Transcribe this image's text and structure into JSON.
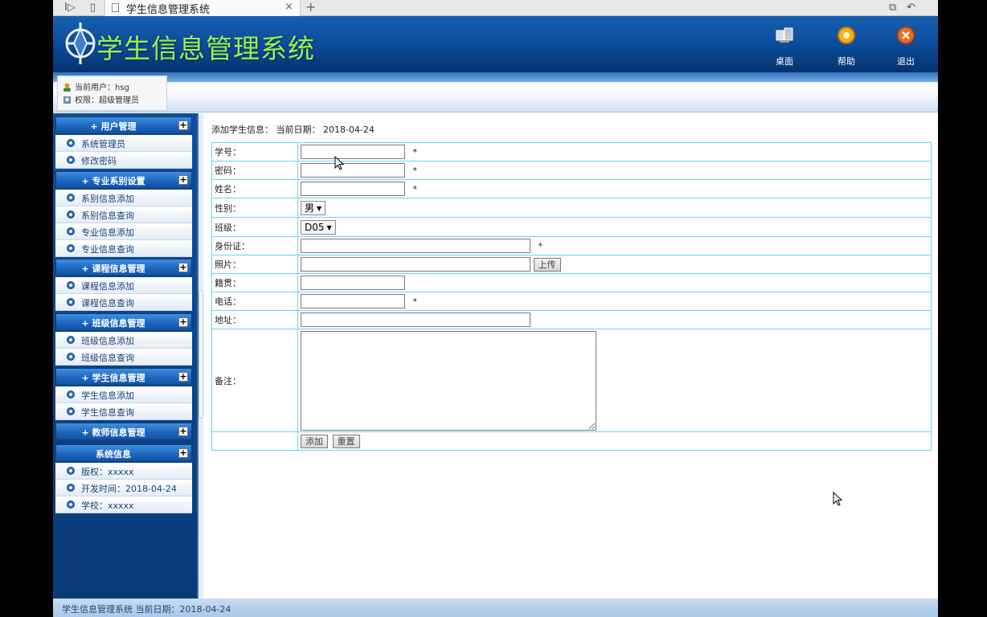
{
  "browser": {
    "tab_title": "学生信息管理系统",
    "tab_close": "×",
    "new_tab": "+"
  },
  "header": {
    "title": "学生信息管理系统",
    "buttons": [
      {
        "label": "桌面",
        "icon": "desktop-icon"
      },
      {
        "label": "帮助",
        "icon": "help-icon"
      },
      {
        "label": "退出",
        "icon": "exit-icon"
      }
    ]
  },
  "userbar": {
    "current_user": "当前用户：hsg",
    "permission": "权限：超级管理员"
  },
  "sidebar": {
    "groups": [
      {
        "title": "+ 用户管理",
        "items": [
          "系统管理员",
          "修改密码"
        ]
      },
      {
        "title": "+ 专业系别设置",
        "items": [
          "系别信息添加",
          "系别信息查询",
          "专业信息添加",
          "专业信息查询"
        ]
      },
      {
        "title": "+ 课程信息管理",
        "items": [
          "课程信息添加",
          "课程信息查询"
        ]
      },
      {
        "title": "+ 班级信息管理",
        "items": [
          "班级信息添加",
          "班级信息查询"
        ]
      },
      {
        "title": "+ 学生信息管理",
        "items": [
          "学生信息添加",
          "学生信息查询"
        ]
      },
      {
        "title": "+ 教师信息管理",
        "items": []
      },
      {
        "title": "系统信息",
        "items": [
          "版权：xxxxx",
          "开发时间：2018-04-24",
          "学校：xxxxx"
        ]
      }
    ]
  },
  "main": {
    "info": "添加学生信息：  当前日期： 2018-04-24",
    "form": {
      "xuehao": {
        "label": "学号：",
        "value": ""
      },
      "mima": {
        "label": "密码：",
        "value": ""
      },
      "xingming": {
        "label": "姓名：",
        "value": ""
      },
      "xingbie": {
        "label": "性别：",
        "value": "男"
      },
      "banji": {
        "label": "班级：",
        "value": "D05"
      },
      "shenfenzheng": {
        "label": "身份证：",
        "value": ""
      },
      "zhaopian": {
        "label": "照片：",
        "value": "",
        "upload": "上传"
      },
      "jiguan": {
        "label": "籍贯：",
        "value": ""
      },
      "dianhua": {
        "label": "电话：",
        "value": ""
      },
      "dizhi": {
        "label": "地址：",
        "value": ""
      },
      "beizhu": {
        "label": "备注：",
        "value": ""
      },
      "required_mark": "*",
      "add_button": "添加",
      "reset_button": "重置"
    }
  },
  "footer": {
    "text": "学生信息管理系统 当前日期：2018-04-24"
  }
}
